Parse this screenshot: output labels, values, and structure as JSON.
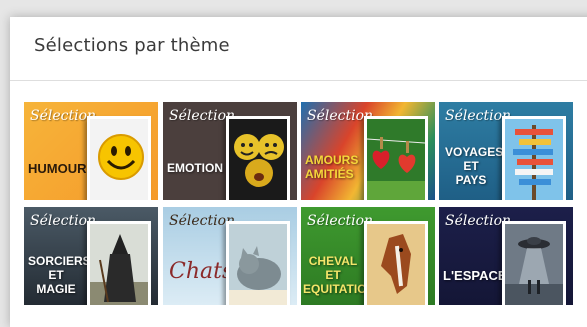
{
  "panel": {
    "title": "Sélections par thème"
  },
  "tiles": [
    {
      "selection": "Sélection",
      "label_lines": [
        "HUMOUR"
      ],
      "image_icon": "smiley-face"
    },
    {
      "selection": "Sélection",
      "label_lines": [
        "EMOTION"
      ],
      "image_icon": "emoji-faces"
    },
    {
      "selection": "Sélection",
      "label_lines": [
        "AMOURS",
        "AMITIÉS"
      ],
      "image_icon": "hearts-clothesline"
    },
    {
      "selection": "Sélection",
      "label_lines": [
        "VOYAGES",
        "ET",
        "PAYS"
      ],
      "image_icon": "signpost"
    },
    {
      "selection": "Sélection",
      "label_lines": [
        "SORCIERS",
        "ET",
        "MAGIE"
      ],
      "image_icon": "witch"
    },
    {
      "selection": "Sélection",
      "label_lines": [
        "Chats"
      ],
      "image_icon": "cat"
    },
    {
      "selection": "Sélection",
      "label_lines": [
        "CHEVAL",
        "ET",
        "EQUITATION"
      ],
      "image_icon": "horse"
    },
    {
      "selection": "Sélection",
      "label_lines": [
        "L'ESPACE"
      ],
      "image_icon": "ufo"
    }
  ]
}
